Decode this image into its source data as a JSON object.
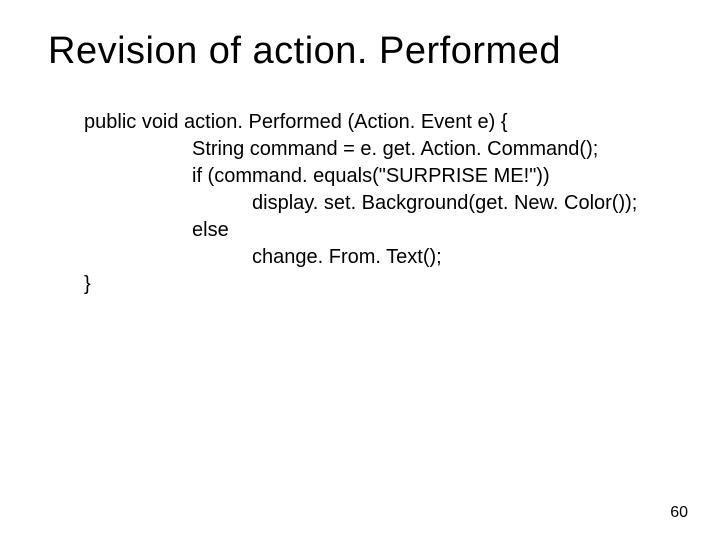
{
  "title": "Revision of action. Performed",
  "code": {
    "l1": "public void action. Performed (Action. Event e) {",
    "l2": "String command = e. get. Action. Command();",
    "l3": "if (command. equals(\"SURPRISE ME!\"))",
    "l4": "display. set. Background(get. New. Color());",
    "l5": "else",
    "l6": "change. From. Text();",
    "l7": "}"
  },
  "page_number": "60"
}
